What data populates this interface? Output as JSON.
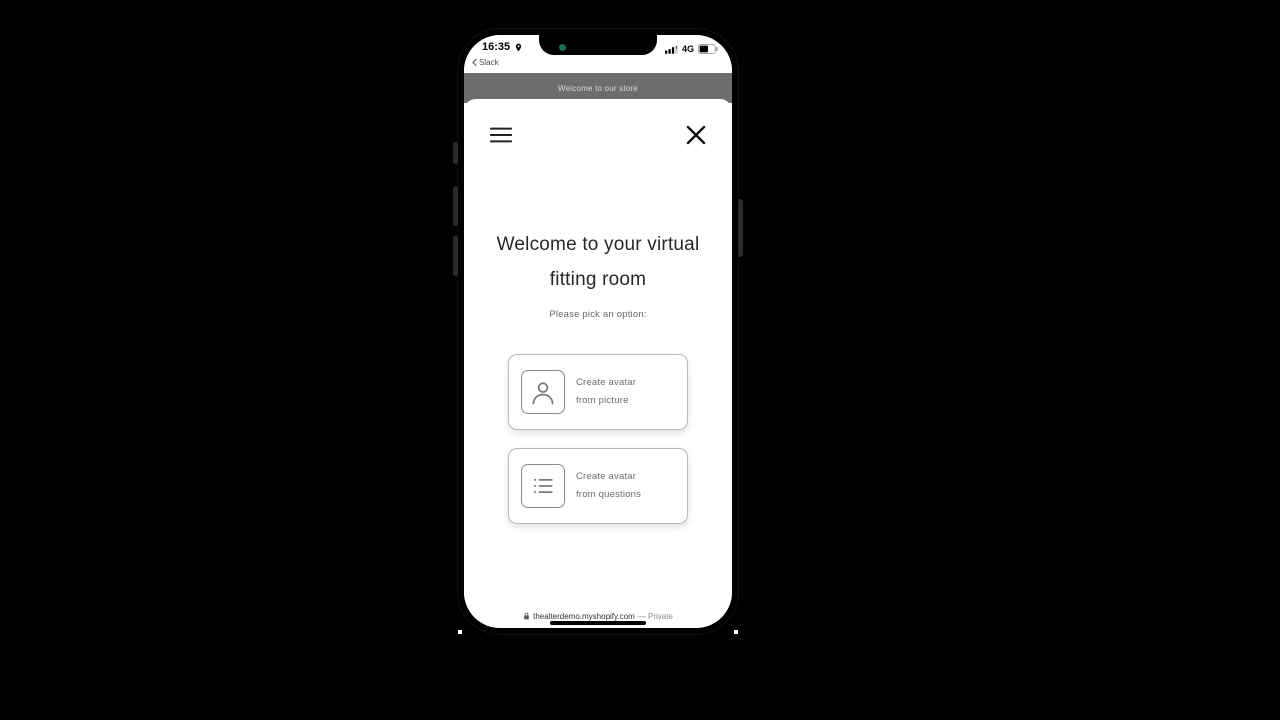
{
  "status": {
    "time": "16:35",
    "back_app": "Slack",
    "network_label": "4G"
  },
  "banner": {
    "text": "Welcome to our store"
  },
  "sheet": {
    "title_line1": "Welcome to your virtual",
    "title_line2": "fitting room",
    "subtitle": "Please pick an option:",
    "options": [
      {
        "label_line1": "Create avatar",
        "label_line2": "from picture"
      },
      {
        "label_line1": "Create avatar",
        "label_line2": "from questions"
      }
    ]
  },
  "browser": {
    "domain": "thealterdemo.myshopify.com",
    "suffix": " — Private"
  }
}
